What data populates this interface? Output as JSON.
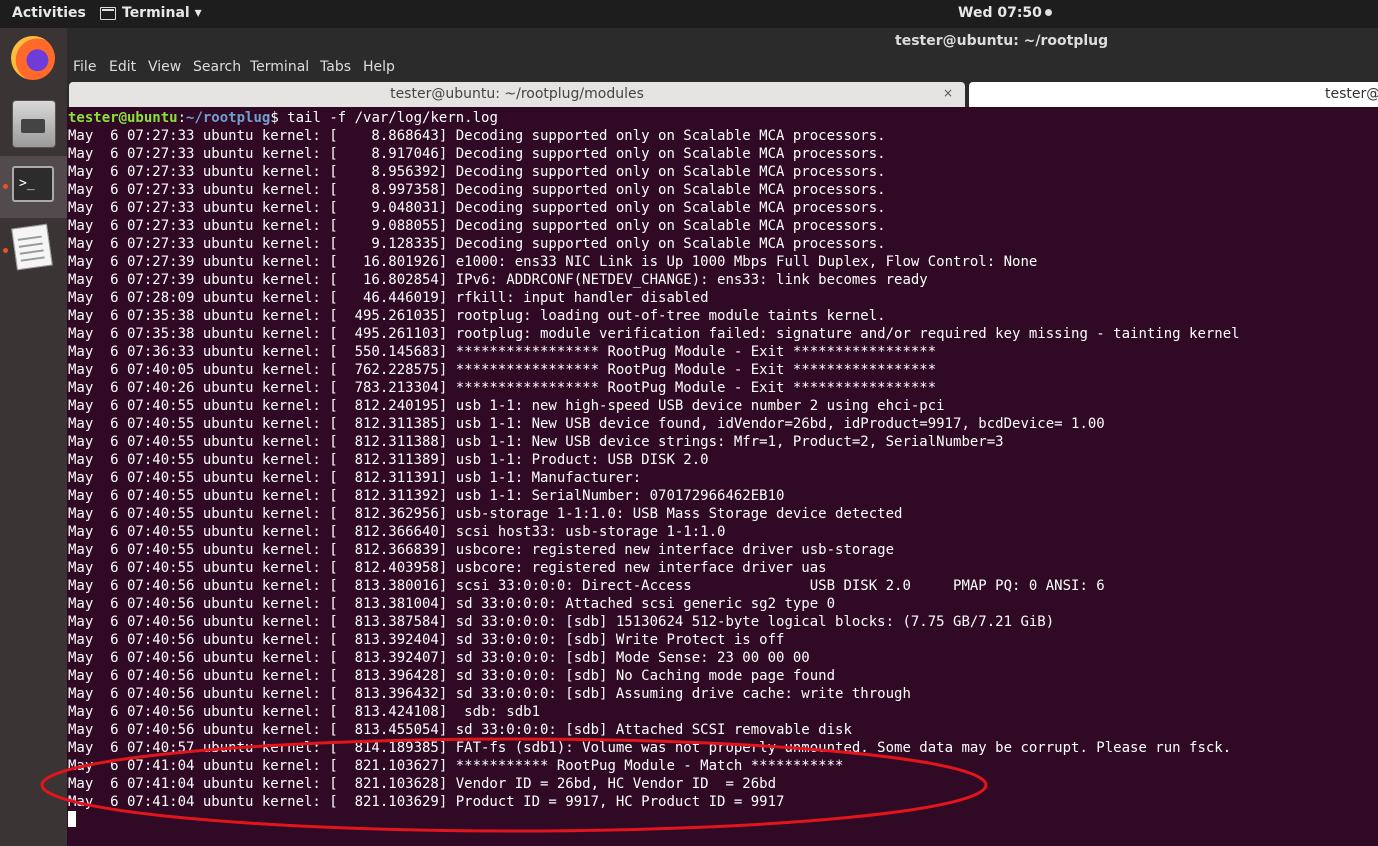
{
  "top_bar": {
    "activities": "Activities",
    "app": "Terminal ▾",
    "clock": "Wed 07:50"
  },
  "window": {
    "title": "tester@ubuntu: ~/rootplug"
  },
  "menu": [
    "File",
    "Edit",
    "View",
    "Search",
    "Terminal",
    "Tabs",
    "Help"
  ],
  "tabs": [
    {
      "label": "tester@ubuntu: ~/rootplug/modules",
      "close": "×"
    },
    {
      "label": "tester@"
    }
  ],
  "prompt": {
    "user": "tester@ubuntu",
    "sep": ":",
    "path": "~/rootplug",
    "symbol": "$ ",
    "command": "tail -f /var/log/kern.log"
  },
  "log_lines": [
    "May  6 07:27:33 ubuntu kernel: [    8.868643] Decoding supported only on Scalable MCA processors.",
    "May  6 07:27:33 ubuntu kernel: [    8.917046] Decoding supported only on Scalable MCA processors.",
    "May  6 07:27:33 ubuntu kernel: [    8.956392] Decoding supported only on Scalable MCA processors.",
    "May  6 07:27:33 ubuntu kernel: [    8.997358] Decoding supported only on Scalable MCA processors.",
    "May  6 07:27:33 ubuntu kernel: [    9.048031] Decoding supported only on Scalable MCA processors.",
    "May  6 07:27:33 ubuntu kernel: [    9.088055] Decoding supported only on Scalable MCA processors.",
    "May  6 07:27:33 ubuntu kernel: [    9.128335] Decoding supported only on Scalable MCA processors.",
    "May  6 07:27:39 ubuntu kernel: [   16.801926] e1000: ens33 NIC Link is Up 1000 Mbps Full Duplex, Flow Control: None",
    "May  6 07:27:39 ubuntu kernel: [   16.802854] IPv6: ADDRCONF(NETDEV_CHANGE): ens33: link becomes ready",
    "May  6 07:28:09 ubuntu kernel: [   46.446019] rfkill: input handler disabled",
    "May  6 07:35:38 ubuntu kernel: [  495.261035] rootplug: loading out-of-tree module taints kernel.",
    "May  6 07:35:38 ubuntu kernel: [  495.261103] rootplug: module verification failed: signature and/or required key missing - tainting kernel",
    "May  6 07:36:33 ubuntu kernel: [  550.145683] ***************** RootPug Module - Exit *****************",
    "May  6 07:40:05 ubuntu kernel: [  762.228575] ***************** RootPug Module - Exit *****************",
    "May  6 07:40:26 ubuntu kernel: [  783.213304] ***************** RootPug Module - Exit *****************",
    "May  6 07:40:55 ubuntu kernel: [  812.240195] usb 1-1: new high-speed USB device number 2 using ehci-pci",
    "May  6 07:40:55 ubuntu kernel: [  812.311385] usb 1-1: New USB device found, idVendor=26bd, idProduct=9917, bcdDevice= 1.00",
    "May  6 07:40:55 ubuntu kernel: [  812.311388] usb 1-1: New USB device strings: Mfr=1, Product=2, SerialNumber=3",
    "May  6 07:40:55 ubuntu kernel: [  812.311389] usb 1-1: Product: USB DISK 2.0",
    "May  6 07:40:55 ubuntu kernel: [  812.311391] usb 1-1: Manufacturer:",
    "May  6 07:40:55 ubuntu kernel: [  812.311392] usb 1-1: SerialNumber: 070172966462EB10",
    "May  6 07:40:55 ubuntu kernel: [  812.362956] usb-storage 1-1:1.0: USB Mass Storage device detected",
    "May  6 07:40:55 ubuntu kernel: [  812.366640] scsi host33: usb-storage 1-1:1.0",
    "May  6 07:40:55 ubuntu kernel: [  812.366839] usbcore: registered new interface driver usb-storage",
    "May  6 07:40:55 ubuntu kernel: [  812.403958] usbcore: registered new interface driver uas",
    "May  6 07:40:56 ubuntu kernel: [  813.380016] scsi 33:0:0:0: Direct-Access              USB DISK 2.0     PMAP PQ: 0 ANSI: 6",
    "May  6 07:40:56 ubuntu kernel: [  813.381004] sd 33:0:0:0: Attached scsi generic sg2 type 0",
    "May  6 07:40:56 ubuntu kernel: [  813.387584] sd 33:0:0:0: [sdb] 15130624 512-byte logical blocks: (7.75 GB/7.21 GiB)",
    "May  6 07:40:56 ubuntu kernel: [  813.392404] sd 33:0:0:0: [sdb] Write Protect is off",
    "May  6 07:40:56 ubuntu kernel: [  813.392407] sd 33:0:0:0: [sdb] Mode Sense: 23 00 00 00",
    "May  6 07:40:56 ubuntu kernel: [  813.396428] sd 33:0:0:0: [sdb] No Caching mode page found",
    "May  6 07:40:56 ubuntu kernel: [  813.396432] sd 33:0:0:0: [sdb] Assuming drive cache: write through",
    "May  6 07:40:56 ubuntu kernel: [  813.424108]  sdb: sdb1",
    "May  6 07:40:56 ubuntu kernel: [  813.455054] sd 33:0:0:0: [sdb] Attached SCSI removable disk",
    "May  6 07:40:57 ubuntu kernel: [  814.189385] FAT-fs (sdb1): Volume was not properly unmounted. Some data may be corrupt. Please run fsck.",
    "May  6 07:41:04 ubuntu kernel: [  821.103627] *********** RootPug Module - Match ***********",
    "May  6 07:41:04 ubuntu kernel: [  821.103628] Vendor ID = 26bd, HC Vendor ID  = 26bd",
    "May  6 07:41:04 ubuntu kernel: [  821.103629] Product ID = 9917, HC Product ID = 9917"
  ],
  "colors": {
    "terminal_bg": "#300a24",
    "annotation": "#e3141b",
    "prompt_user": "#8ae234",
    "prompt_path": "#729fcf"
  },
  "dock_icons": [
    "firefox-icon",
    "files-icon",
    "terminal-icon",
    "text-editor-icon"
  ]
}
